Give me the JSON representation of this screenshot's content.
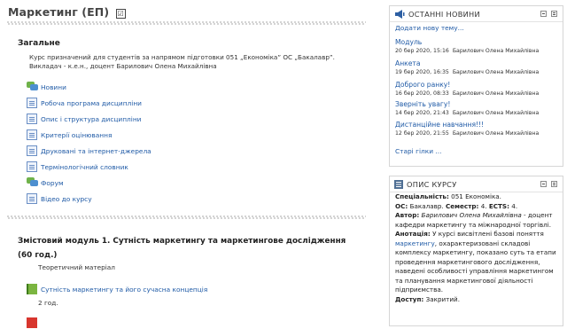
{
  "course": {
    "title": "Маркетинг (ЕП)",
    "title_check": "☑"
  },
  "general": {
    "heading": "Загальне",
    "summary": "Курс призначений для студентів за напрямом підготовки 051 „Економіка” ОС „Бакалавр”. Викладач - к.е.н., доцент Барилович Олена Михайлівна",
    "activities": [
      {
        "icon": "forum-icon",
        "label": "Новини"
      },
      {
        "icon": "file-icon",
        "label": "Робоча програма дисципліни"
      },
      {
        "icon": "file-icon",
        "label": "Опис і структура дисципліни"
      },
      {
        "icon": "file-icon",
        "label": "Критерії оцінювання"
      },
      {
        "icon": "file-icon",
        "label": "Друковані та інтернет-джерела"
      },
      {
        "icon": "file-icon",
        "label": "Термінологічний словник"
      },
      {
        "icon": "forum-icon",
        "label": "Форум"
      },
      {
        "icon": "file-icon",
        "label": "Відео до курсу"
      }
    ]
  },
  "module1": {
    "heading": "Змістовий модуль 1. Сутність маркетингу та маркетингове дослідження (60 год.)",
    "label_theory": "Теоретичний матеріал",
    "book_link": "Сутність маркетингу та його сучасна концепція",
    "hours": "2 год."
  },
  "latest_news": {
    "title": "ОСТАННІ НОВИНИ",
    "add_link": "Додати нову тему...",
    "items": [
      {
        "title": "Модуль",
        "date": "20 бер 2020, 15:16",
        "author": "Барилович Олена Михайлівна"
      },
      {
        "title": "Анкета",
        "date": "19 бер 2020, 16:35",
        "author": "Барилович Олена Михайлівна"
      },
      {
        "title": "Доброго ранку!",
        "date": "16 бер 2020, 08:33",
        "author": "Барилович Олена Михайлівна"
      },
      {
        "title": "Зверніть увагу!",
        "date": "14 бер 2020, 21:43",
        "author": "Барилович Олена Михайлівна"
      },
      {
        "title": "Дистанційне навчання!!!",
        "date": "12 бер 2020, 21:55",
        "author": "Барилович Олена Михайлівна"
      }
    ],
    "older_link": "Старі гілки ..."
  },
  "course_desc": {
    "title": "ОПИС КУРСУ",
    "spec_label": "Спеціальність:",
    "spec_value": "051 Економіка.",
    "os_label": "ОС:",
    "os_value": "Бакалавр.",
    "sem_label": "Семестр:",
    "sem_value": "4.",
    "ects_label": "ECTS:",
    "ects_value": "4.",
    "author_label": "Автор:",
    "author_value": "Барилович Олена Михайлівна",
    "author_rest": "- доцент кафедри маркетингу та міжнародної торгівлі.",
    "annot_label": "Анотація:",
    "annot_pre": "У курсі висвітлені базові поняття",
    "annot_link": "маркетингу",
    "annot_post": ", охарактеризовані складові комплексу маркетингу, показано суть та етапи проведення маркетингового дослідження, наведені особливості управління маркетингом та планування маркетингової діяльності підприємства.",
    "access_label": "Доступ:",
    "access_value": "Закритий."
  },
  "colors": {
    "link": "#1f5aa6",
    "forum_green": "#6fb24a",
    "forum_blue": "#4d8fd0",
    "book_green": "#7bb540",
    "pdf_red": "#d8362e"
  }
}
